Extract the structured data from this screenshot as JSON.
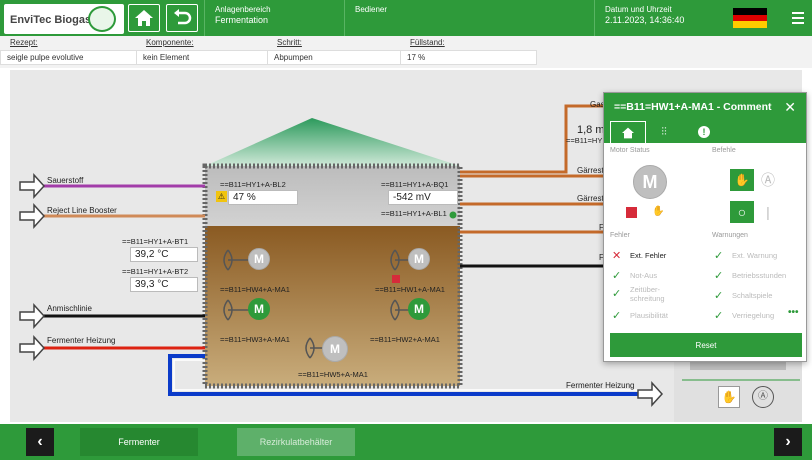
{
  "header": {
    "logo_text": "EnviTec Biogas",
    "area_label": "Anlagenbereich",
    "area_value": "Fermentation",
    "user_label": "Bediener",
    "datetime_label": "Datum und Uhrzeit",
    "datetime_value": "2.11.2023, 14:36:40",
    "colors": {
      "primary": "#2e9a3a"
    }
  },
  "info": {
    "rezept_label": "Rezept:",
    "rezept_value": "seigle pulpe evolutive",
    "komponente_label": "Komponente:",
    "komponente_value": "kein Element",
    "schritt_label": "Schritt:",
    "schritt_value": "Abpumpen",
    "fuellstand_label": "Füllstand:",
    "fuellstand_value": "17 %"
  },
  "process": {
    "inlets": [
      "Sauerstoff",
      "Reject Line Booster",
      "Anmischlinie",
      "Fermenter Heizung"
    ],
    "outlet_heizung": "Fermenter Heizung",
    "gas_label": "Gas",
    "flow_value": "1,8 m",
    "flow_tag": "==B11=HY",
    "gaerrest1": "Gärrest",
    "gaerrest2": "Gärrest",
    "f1": "F",
    "f2": "F",
    "level_tag": "==B11=HY1+A-BL2",
    "level_value": "47 %",
    "redox_tag": "==B11=HY1+A-BQ1",
    "redox_value": "-542 mV",
    "level_switch_tag": "==B11=HY1+A-BL1",
    "temp1_tag": "==B11=HY1+A-BT1",
    "temp1_value": "39,2 °C",
    "temp2_tag": "==B11=HY1+A-BT2",
    "temp2_value": "39,3 °C",
    "motor_hw4": "==B11=HW4+A-MA1",
    "motor_hw1": "==B11=HW1+A-MA1",
    "motor_hw3": "==B11=HW3+A-MA1",
    "motor_hw2": "==B11=HW2+A-MA1",
    "motor_hw5": "==B11=HW5+A-MA1",
    "motor_letter": "M"
  },
  "panel": {
    "title": "==B11=HW1+A-MA1 - Comment",
    "motor_status_label": "Motor Status",
    "befehle_label": "Befehle",
    "fehler_label": "Fehler",
    "warnungen_label": "Warnungen",
    "fehler": [
      "Ext. Fehler",
      "Not-Aus",
      "Zeitüber-\nschreitung",
      "Plausibilität"
    ],
    "warnungen": [
      "Ext. Warnung",
      "Betriebsstunden",
      "Schaltspiele",
      "Verriegelung"
    ],
    "reset_label": "Reset",
    "more": "•••"
  },
  "footer": {
    "fermenter_label": "Fermenter",
    "rezirkulat_label": "Rezirkulatbehälter"
  }
}
